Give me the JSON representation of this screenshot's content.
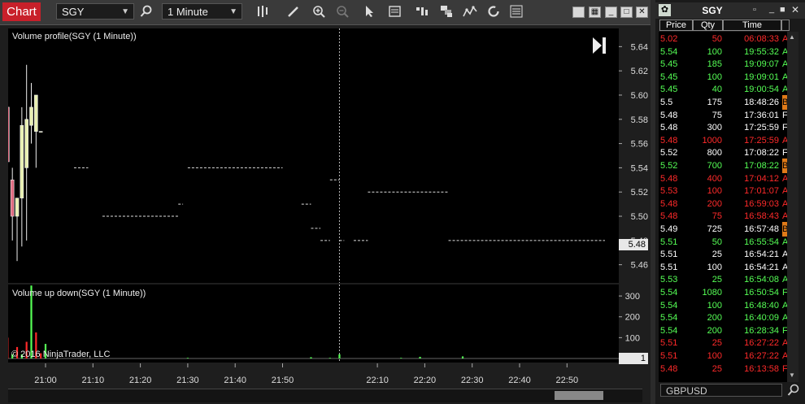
{
  "toolbar": {
    "window_tab": "Chart",
    "instrument": "SGY",
    "interval": "1 Minute",
    "icons": [
      "search-icon",
      "bar-type-icon",
      "pencil-icon",
      "zoom-in-icon",
      "zoom-out-icon",
      "pointer-icon",
      "data-box-icon",
      "strategy-icon",
      "templates-icon",
      "indicators-icon",
      "refresh-icon",
      "properties-icon"
    ]
  },
  "price_panel": {
    "title": "Volume profile(SGY (1 Minute))",
    "ticks": [
      "5.64",
      "5.62",
      "5.60",
      "5.58",
      "5.56",
      "5.54",
      "5.52",
      "5.50",
      "5.48",
      "5.46"
    ],
    "current_price": "5.48",
    "ylim": [
      5.445,
      5.655
    ]
  },
  "volume_panel": {
    "title": "Volume up down(SGY (1 Minute))",
    "ticks": [
      "300",
      "200",
      "100"
    ],
    "current_value": "1",
    "copyright": "© 2016 NinjaTrader, LLC",
    "ylim": [
      0,
      355
    ]
  },
  "time_axis": {
    "ticks": [
      "21:00",
      "21:10",
      "21:20",
      "21:30",
      "21:40",
      "21:50",
      "22:10",
      "22:20",
      "22:30",
      "22:40",
      "22:50"
    ],
    "start_minute": 1252,
    "end_minute": 1381
  },
  "candles": [
    {
      "t": 1251,
      "open": 5.575,
      "high": 5.605,
      "low": 5.535,
      "close": 5.6,
      "up": true
    },
    {
      "t": 1252,
      "open": 5.59,
      "high": 5.6,
      "low": 5.535,
      "close": 5.545,
      "up": false
    },
    {
      "t": 1253,
      "open": 5.53,
      "high": 5.54,
      "low": 5.48,
      "close": 5.5,
      "up": false
    },
    {
      "t": 1254,
      "open": 5.5,
      "high": 5.515,
      "low": 5.463,
      "close": 5.515,
      "up": true
    },
    {
      "t": 1255,
      "open": 5.515,
      "high": 5.59,
      "low": 5.475,
      "close": 5.575,
      "up": true
    },
    {
      "t": 1256,
      "open": 5.54,
      "high": 5.625,
      "low": 5.48,
      "close": 5.58,
      "up": true
    },
    {
      "t": 1257,
      "open": 5.575,
      "high": 5.61,
      "low": 5.56,
      "close": 5.59,
      "up": true
    },
    {
      "t": 1258,
      "open": 5.57,
      "high": 5.6,
      "low": 5.54,
      "close": 5.6,
      "up": true
    },
    {
      "t": 1259,
      "open": 5.57,
      "high": 5.57,
      "low": 5.57,
      "close": 5.57,
      "up": true
    }
  ],
  "profile_levels": [
    {
      "price": 5.54,
      "t1": 1266,
      "t2": 1269
    },
    {
      "price": 5.5,
      "t1": 1272,
      "t2": 1288
    },
    {
      "price": 5.51,
      "t1": 1288,
      "t2": 1289
    },
    {
      "price": 5.54,
      "t1": 1290,
      "t2": 1310
    },
    {
      "price": 5.51,
      "t1": 1314,
      "t2": 1316
    },
    {
      "price": 5.49,
      "t1": 1316,
      "t2": 1318
    },
    {
      "price": 5.48,
      "t1": 1318,
      "t2": 1320
    },
    {
      "price": 5.53,
      "t1": 1320,
      "t2": 1322
    },
    {
      "price": 5.48,
      "t1": 1322,
      "t2": 1323
    },
    {
      "price": 5.48,
      "t1": 1325,
      "t2": 1328
    },
    {
      "price": 5.52,
      "t1": 1328,
      "t2": 1345
    },
    {
      "price": 5.48,
      "t1": 1345,
      "t2": 1378
    }
  ],
  "volume_bars": [
    {
      "t": 1251,
      "v": 60,
      "up": true
    },
    {
      "t": 1252,
      "v": 100,
      "up": false
    },
    {
      "t": 1253,
      "v": 20,
      "up": true
    },
    {
      "t": 1254,
      "v": 55,
      "up": false
    },
    {
      "t": 1255,
      "v": 20,
      "up": true
    },
    {
      "t": 1256,
      "v": 80,
      "up": false
    },
    {
      "t": 1257,
      "v": 350,
      "up": true
    },
    {
      "t": 1258,
      "v": 125,
      "up": false
    },
    {
      "t": 1259,
      "v": 25,
      "up": false
    },
    {
      "t": 1260,
      "v": 70,
      "up": true
    },
    {
      "t": 1290,
      "v": 3,
      "up": true
    },
    {
      "t": 1316,
      "v": 6,
      "up": true
    },
    {
      "t": 1320,
      "v": 3,
      "up": true
    },
    {
      "t": 1322,
      "v": 20,
      "up": true
    },
    {
      "t": 1335,
      "v": 3,
      "up": true
    },
    {
      "t": 1339,
      "v": 8,
      "up": true
    },
    {
      "t": 1348,
      "v": 10,
      "up": true
    }
  ],
  "crosshair_minute": 1322,
  "time_and_sales": {
    "title": "SGY",
    "headers": [
      "Price",
      "Qty",
      "Time"
    ],
    "rows": [
      {
        "price": "5.02",
        "qty": "50",
        "time": "06:08:33",
        "cond": "A",
        "color": "#ff2a2a"
      },
      {
        "price": "5.54",
        "qty": "100",
        "time": "19:55:32",
        "cond": "A",
        "color": "#55ff55"
      },
      {
        "price": "5.45",
        "qty": "185",
        "time": "19:09:07",
        "cond": "A",
        "color": "#55ff55"
      },
      {
        "price": "5.45",
        "qty": "100",
        "time": "19:09:01",
        "cond": "A",
        "color": "#55ff55"
      },
      {
        "price": "5.45",
        "qty": "40",
        "time": "19:00:54",
        "cond": "A",
        "color": "#55ff55"
      },
      {
        "price": "5.5",
        "qty": "175",
        "time": "18:48:26",
        "cond": "B",
        "color": "#ffffff",
        "badge": true
      },
      {
        "price": "5.48",
        "qty": "75",
        "time": "17:36:01",
        "cond": "F",
        "color": "#ffffff"
      },
      {
        "price": "5.48",
        "qty": "300",
        "time": "17:25:59",
        "cond": "F",
        "color": "#ffffff"
      },
      {
        "price": "5.48",
        "qty": "1000",
        "time": "17:25:59",
        "cond": "A",
        "color": "#ff2a2a"
      },
      {
        "price": "5.52",
        "qty": "800",
        "time": "17:08:22",
        "cond": "F",
        "color": "#ffffff"
      },
      {
        "price": "5.52",
        "qty": "700",
        "time": "17:08:22",
        "cond": "B",
        "color": "#55ff55",
        "badge": true
      },
      {
        "price": "5.48",
        "qty": "400",
        "time": "17:04:12",
        "cond": "A",
        "color": "#ff2a2a"
      },
      {
        "price": "5.53",
        "qty": "100",
        "time": "17:01:07",
        "cond": "A",
        "color": "#ff2a2a"
      },
      {
        "price": "5.48",
        "qty": "200",
        "time": "16:59:03",
        "cond": "A",
        "color": "#ff2a2a"
      },
      {
        "price": "5.48",
        "qty": "75",
        "time": "16:58:43",
        "cond": "A",
        "color": "#ff2a2a"
      },
      {
        "price": "5.49",
        "qty": "725",
        "time": "16:57:48",
        "cond": "B",
        "color": "#ffffff",
        "badge": true
      },
      {
        "price": "5.51",
        "qty": "50",
        "time": "16:55:54",
        "cond": "A",
        "color": "#55ff55"
      },
      {
        "price": "5.51",
        "qty": "25",
        "time": "16:54:21",
        "cond": "A",
        "color": "#ffffff"
      },
      {
        "price": "5.51",
        "qty": "100",
        "time": "16:54:21",
        "cond": "A",
        "color": "#ffffff"
      },
      {
        "price": "5.53",
        "qty": "25",
        "time": "16:54:08",
        "cond": "A",
        "color": "#55ff55"
      },
      {
        "price": "5.54",
        "qty": "1080",
        "time": "16:50:54",
        "cond": "F",
        "color": "#55ff55"
      },
      {
        "price": "5.54",
        "qty": "100",
        "time": "16:48:40",
        "cond": "A",
        "color": "#55ff55"
      },
      {
        "price": "5.54",
        "qty": "200",
        "time": "16:40:09",
        "cond": "A",
        "color": "#55ff55"
      },
      {
        "price": "5.54",
        "qty": "200",
        "time": "16:28:34",
        "cond": "F",
        "color": "#55ff55"
      },
      {
        "price": "5.51",
        "qty": "25",
        "time": "16:27:22",
        "cond": "A",
        "color": "#ff2a2a"
      },
      {
        "price": "5.51",
        "qty": "100",
        "time": "16:27:22",
        "cond": "A",
        "color": "#ff2a2a"
      },
      {
        "price": "5.48",
        "qty": "25",
        "time": "16:13:58",
        "cond": "F",
        "color": "#ff2a2a"
      }
    ]
  },
  "background_window": {
    "instrument": "GBPUSD"
  },
  "colors": {
    "up": "#55ff55",
    "down": "#ff2a2a",
    "candle_up": "#e8f0b0",
    "candle_down": "#e06a80",
    "accent": "#c8202a"
  }
}
